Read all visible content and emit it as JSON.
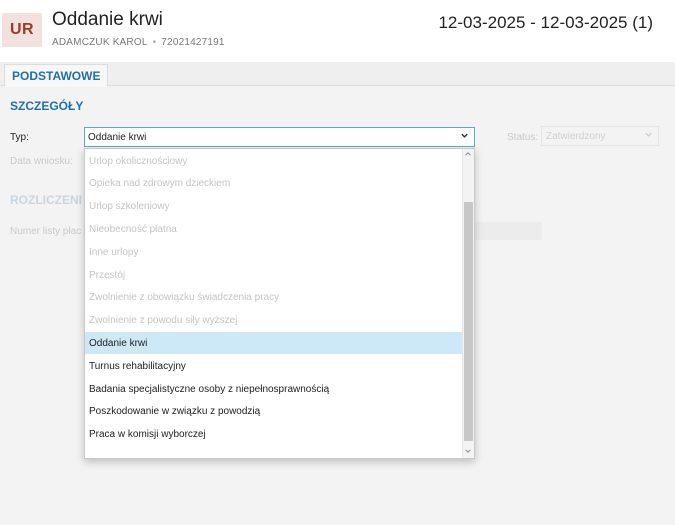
{
  "header": {
    "avatar": "UR",
    "title": "Oddanie krwi",
    "employee_name": "ADAMCZUK KAROL",
    "employee_id": "72021427191",
    "separator": "•",
    "date_range": "12-03-2025 - 12-03-2025 (1)"
  },
  "tabs": [
    {
      "label": "PODSTAWOWE"
    }
  ],
  "details": {
    "section_title": "SZCZEGÓŁY",
    "type_label": "Typ:",
    "type_value": "Oddanie krwi",
    "date_label": "Data wniosku:",
    "status_label": "Status:",
    "status_value": "Zatwierdzony"
  },
  "settlement": {
    "section_title": "ROZLICZENI",
    "payroll_label": "Numer listy płac"
  },
  "dropdown": {
    "options": [
      {
        "label": "Urlop okolicznościowy",
        "state": "disabled"
      },
      {
        "label": "Opieka nad zdrowym dzieckiem",
        "state": "disabled"
      },
      {
        "label": "Urlop szkoleniowy",
        "state": "disabled"
      },
      {
        "label": "Nieobecność płatna",
        "state": "disabled"
      },
      {
        "label": "Inne urlopy",
        "state": "disabled"
      },
      {
        "label": "Przestój",
        "state": "disabled"
      },
      {
        "label": "Zwolnienie z obowiązku świadczenia pracy",
        "state": "disabled"
      },
      {
        "label": "Zwolnienie z powodu siły wyższej",
        "state": "disabled"
      },
      {
        "label": "Oddanie krwi",
        "state": "selected"
      },
      {
        "label": "Turnus rehabilitacyjny",
        "state": "enabled"
      },
      {
        "label": "Badania specjalistyczne osoby z niepełnosprawnością",
        "state": "enabled"
      },
      {
        "label": "Poszkodowanie w związku z powodzią",
        "state": "enabled"
      },
      {
        "label": "Praca w komisji wyborczej",
        "state": "enabled"
      }
    ]
  },
  "colors": {
    "accent": "#1f6fae",
    "avatar_bg": "#f2e1dc",
    "avatar_text": "#9b3b2a",
    "selected_bg": "#cde8f6",
    "focus_border": "#59a8d8"
  },
  "icons": {
    "select_chevron": "chevron-down-icon",
    "scroll_up": "scroll-up-arrow-icon",
    "scroll_down": "scroll-down-arrow-icon"
  }
}
